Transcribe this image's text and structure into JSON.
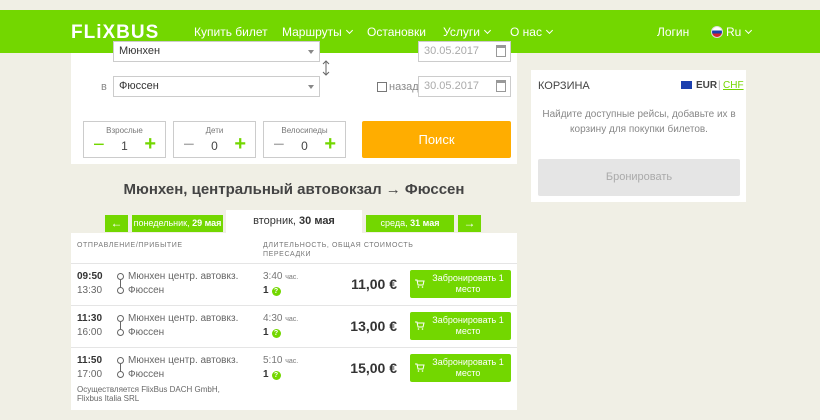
{
  "header": {
    "logo": "FLiXBUS",
    "nav": {
      "buy": "Купить билет",
      "routes": "Маршруты",
      "stops": "Остановки",
      "services": "Услуги",
      "about": "О нас",
      "login": "Логин",
      "language": "Ru"
    }
  },
  "search": {
    "from_value": "Мюнхен",
    "to_label": "в",
    "to_value": "Фюссен",
    "return_label": "назад",
    "return_date": "30.05.2017",
    "date_value": "30.05.2017",
    "counters": [
      {
        "label": "Взрослые",
        "value": "1"
      },
      {
        "label": "Дети",
        "value": "0"
      },
      {
        "label": "Велосипеды",
        "value": "0"
      }
    ],
    "submit_label": "Поиск"
  },
  "cart": {
    "title": "КОРЗИНА",
    "currency_eur": "EUR",
    "separator": "|",
    "currency_chf": "CHF",
    "text": "Найдите доступные рейсы, добавьте их в корзину для покупки билетов.",
    "book_label": "Бронировать"
  },
  "route_title": "Мюнхен, центральный автовокзал → Фюссен",
  "dates": {
    "prev_arrow": "←",
    "next_arrow": "→",
    "prev": {
      "day": "понедельник,",
      "date": "29 мая"
    },
    "current": {
      "day": "вторник,",
      "date": "30 мая"
    },
    "next": {
      "day": "среда,",
      "date": "31 мая"
    }
  },
  "results": {
    "col_departure": "ОТПРАВЛЕНИЕ/ПРИБЫТИЕ",
    "col_duration_line1": "ДЛИТЕЛЬНОСТЬ,",
    "col_duration_line2": "ПЕРЕСАДКИ",
    "col_price": "ОБЩАЯ СТОИМОСТЬ",
    "rows": [
      {
        "dep": "09:50",
        "arr": "13:30",
        "from": "Мюнхен центр. автовкз.",
        "to": "Фюссен",
        "duration": "3:40",
        "duration_unit": "час.",
        "transfers": "1",
        "price": "11,00 €",
        "book_label": "Забронировать 1 место"
      },
      {
        "dep": "11:30",
        "arr": "16:00",
        "from": "Мюнхен центр. автовкз.",
        "to": "Фюссен",
        "duration": "4:30",
        "duration_unit": "час.",
        "transfers": "1",
        "price": "13,00 €",
        "book_label": "Забронировать 1 место"
      },
      {
        "dep": "11:50",
        "arr": "17:00",
        "from": "Мюнхен центр. автовкз.",
        "to": "Фюссен",
        "duration": "5:10",
        "duration_unit": "час.",
        "transfers": "1",
        "price": "15,00 €",
        "book_label": "Забронировать 1 место",
        "operator_line1": "Осуществляется FlixBus DACH GmbH,",
        "operator_line2": "Flixbus Italia SRL"
      }
    ]
  },
  "colors": {
    "green": "#73d700",
    "orange": "#ffad00",
    "background": "#f0efe5"
  }
}
